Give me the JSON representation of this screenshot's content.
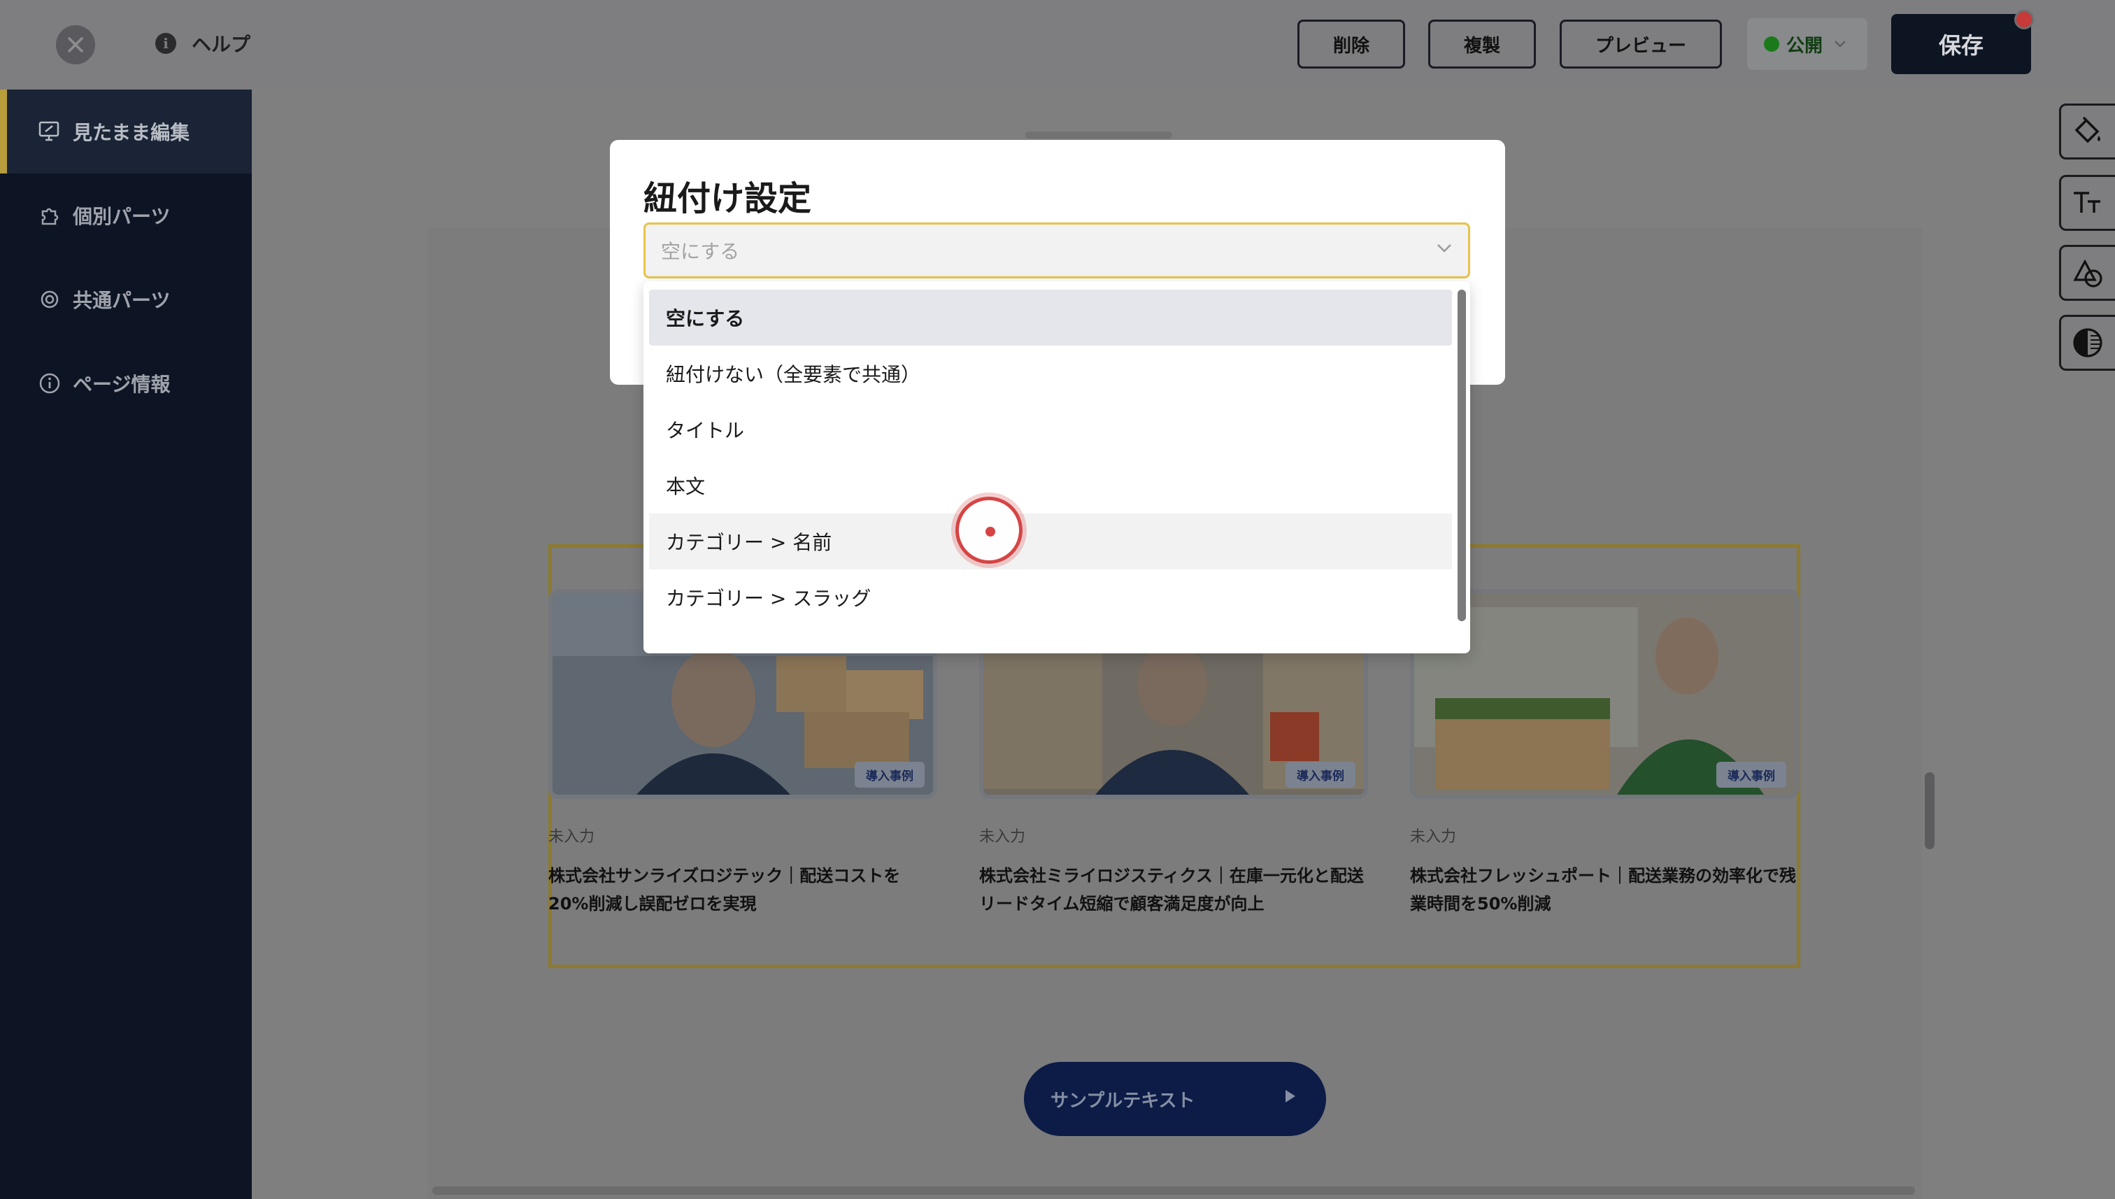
{
  "topbar": {
    "help_label": "ヘルプ",
    "help_icon_glyph": "i",
    "buttons": {
      "delete": "削除",
      "duplicate": "複製",
      "preview": "プレビュー"
    },
    "status": {
      "label": "公開",
      "color": "#1a7a1a"
    },
    "save_label": "保存"
  },
  "sidebar": {
    "items": [
      {
        "label": "見たまま編集",
        "icon": "monitor-edit-icon",
        "active": true
      },
      {
        "label": "個別パーツ",
        "icon": "puzzle-icon",
        "active": false
      },
      {
        "label": "共通パーツ",
        "icon": "shared-parts-icon",
        "active": false
      },
      {
        "label": "ページ情報",
        "icon": "info-icon",
        "active": false
      }
    ]
  },
  "tools": [
    "paint-bucket-icon",
    "text-size-icon",
    "shapes-icon",
    "contrast-icon"
  ],
  "canvas": {
    "cards": [
      {
        "tag": "導入事例",
        "category": "未入力",
        "title": "株式会社サンライズロジテック｜配送コストを20%削減し誤配ゼロを実現"
      },
      {
        "tag": "導入事例",
        "category": "未入力",
        "title": "株式会社ミライロジスティクス｜在庫一元化と配送リードタイム短縮で顧客満足度が向上"
      },
      {
        "tag": "導入事例",
        "category": "未入力",
        "title": "株式会社フレッシュポート｜配送業務の効率化で残業時間を50%削減"
      }
    ],
    "sample_button": "サンプルテキスト"
  },
  "modal": {
    "title": "紐付け設定",
    "select_value": "空にする",
    "options": [
      {
        "label": "空にする",
        "state": "selected"
      },
      {
        "label": "紐付けない（全要素で共通）",
        "state": ""
      },
      {
        "label": "タイトル",
        "state": ""
      },
      {
        "label": "本文",
        "state": ""
      },
      {
        "label": "カテゴリー > 名前",
        "state": "hover"
      },
      {
        "label": "カテゴリー > スラッグ",
        "state": ""
      }
    ]
  },
  "colors": {
    "accent": "#e8c34a",
    "sidebar_bg": "#0d1525",
    "save_bg": "#0d1523",
    "click_indicator": "#d64444"
  }
}
